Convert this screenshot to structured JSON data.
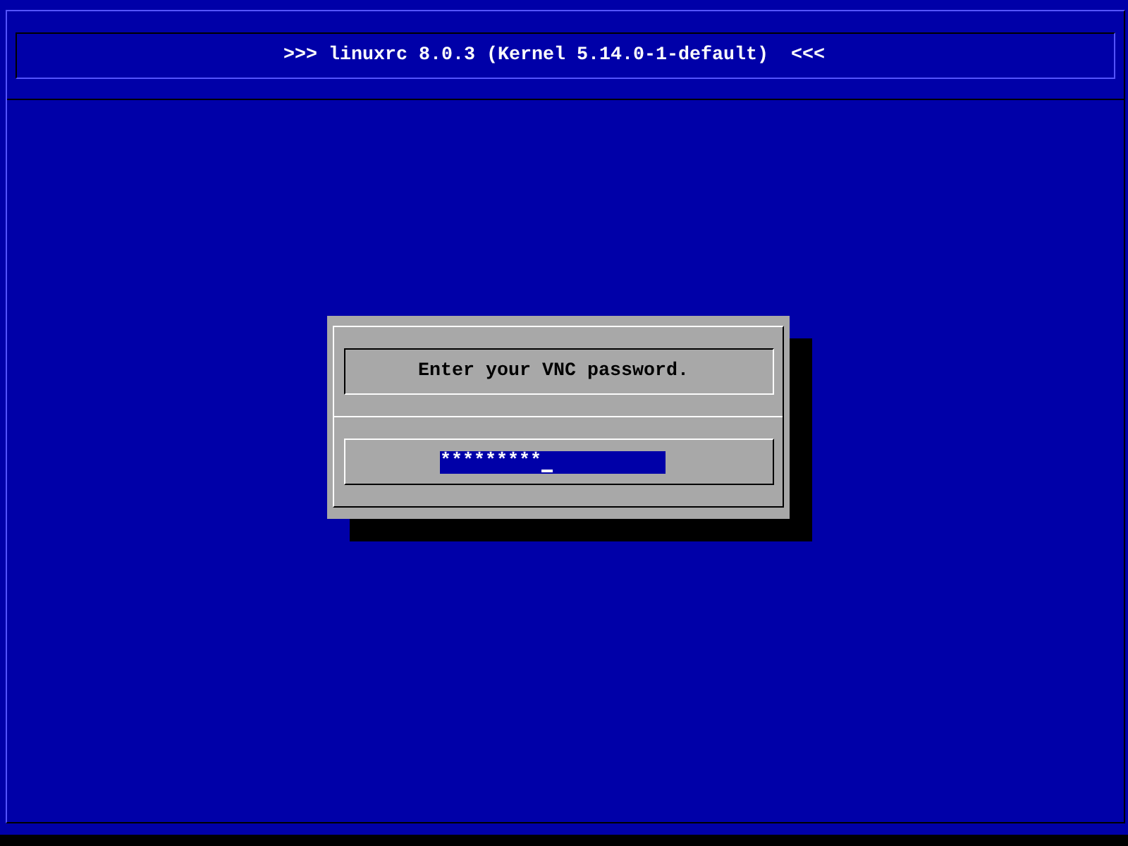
{
  "header": {
    "title": ">>> linuxrc 8.0.3 (Kernel 5.14.0-1-default)  <<<"
  },
  "dialog": {
    "message": "Enter your VNC password.",
    "password": {
      "value": "*********",
      "focused": true
    }
  }
}
